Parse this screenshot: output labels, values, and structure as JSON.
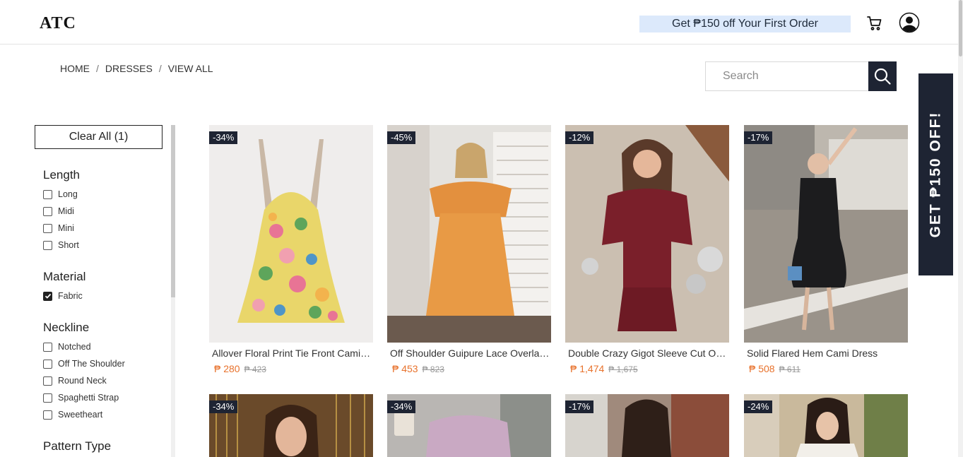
{
  "header": {
    "logo": "ATC",
    "promo": "Get ₱150 off Your First Order",
    "icons": [
      "cart-icon",
      "user-icon"
    ]
  },
  "breadcrumb": [
    "HOME",
    "DRESSES",
    "VIEW ALL"
  ],
  "search": {
    "placeholder": "Search"
  },
  "side_promo": "GET ₱150 OFF!",
  "filters": {
    "clear_all": "Clear All (1)",
    "groups": [
      {
        "title": "Length",
        "options": [
          {
            "label": "Long",
            "checked": false
          },
          {
            "label": "Midi",
            "checked": false
          },
          {
            "label": "Mini",
            "checked": false
          },
          {
            "label": "Short",
            "checked": false
          }
        ]
      },
      {
        "title": "Material",
        "options": [
          {
            "label": "Fabric",
            "checked": true
          }
        ]
      },
      {
        "title": "Neckline",
        "options": [
          {
            "label": "Notched",
            "checked": false
          },
          {
            "label": "Off The Shoulder",
            "checked": false
          },
          {
            "label": "Round Neck",
            "checked": false
          },
          {
            "label": "Spaghetti Strap",
            "checked": false
          },
          {
            "label": "Sweetheart",
            "checked": false
          }
        ]
      },
      {
        "title": "Pattern Type",
        "options": []
      }
    ]
  },
  "products": [
    {
      "badge": "-34%",
      "name": "Allover Floral Print Tie Front Cami Dress",
      "price": "₱ 280",
      "old_price": "₱ 423"
    },
    {
      "badge": "-45%",
      "name": "Off Shoulder Guipure Lace Overlay Dress",
      "price": "₱ 453",
      "old_price": "₱ 823"
    },
    {
      "badge": "-12%",
      "name": "Double Crazy Gigot Sleeve Cut Out Dress",
      "price": "₱ 1,474",
      "old_price": "₱ 1,675"
    },
    {
      "badge": "-17%",
      "name": "Solid Flared Hem Cami Dress",
      "price": "₱ 508",
      "old_price": "₱ 611"
    },
    {
      "badge": "-34%",
      "name": "",
      "price": "",
      "old_price": ""
    },
    {
      "badge": "-34%",
      "name": "",
      "price": "",
      "old_price": ""
    },
    {
      "badge": "-17%",
      "name": "",
      "price": "",
      "old_price": ""
    },
    {
      "badge": "-24%",
      "name": "",
      "price": "",
      "old_price": ""
    }
  ],
  "colors": {
    "accent": "#1e2433",
    "price": "#e8722c",
    "promo_bg": "#dce9fb"
  }
}
